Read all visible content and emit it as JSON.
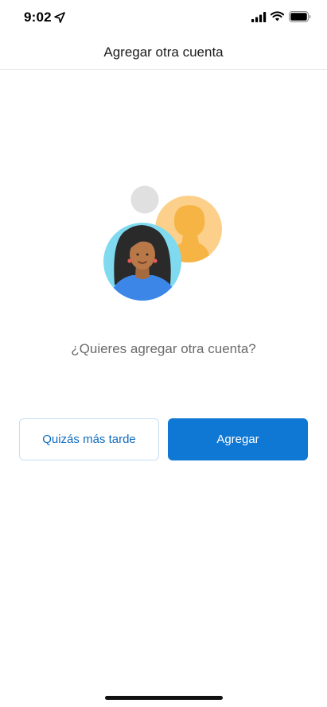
{
  "status_bar": {
    "time": "9:02",
    "location_icon": "location-arrow-icon",
    "signal_icon": "cellular-signal-icon",
    "wifi_icon": "wifi-icon",
    "battery_icon": "battery-icon"
  },
  "header": {
    "title": "Agregar otra cuenta"
  },
  "illustration": {
    "icon": "accounts-illustration-icon",
    "colors": {
      "front_circle": "#7fdaf0",
      "back_circle": "#fcd08a",
      "small_circle": "#e0e0e0",
      "shirt": "#3c86e8"
    }
  },
  "main": {
    "prompt": "¿Quieres agregar otra cuenta?"
  },
  "buttons": {
    "later_label": "Quizás más tarde",
    "add_label": "Agregar"
  },
  "colors": {
    "accent": "#0f78d4",
    "secondary_text": "#6b6b6b"
  }
}
